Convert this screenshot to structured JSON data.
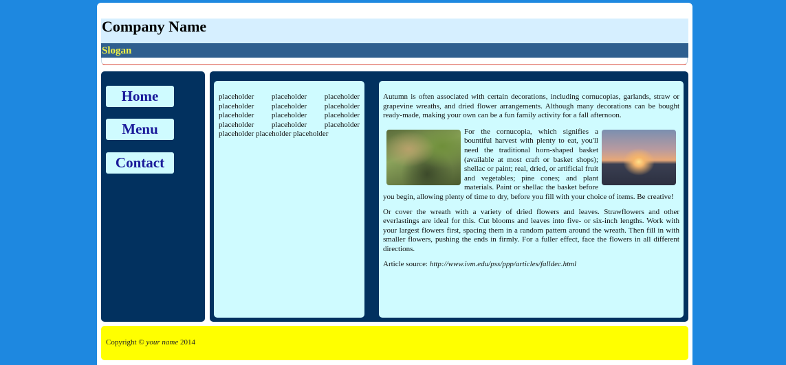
{
  "header": {
    "company_name": "Company Name",
    "slogan": "Slogan"
  },
  "nav": {
    "items": [
      {
        "label": "Home"
      },
      {
        "label": "Menu"
      },
      {
        "label": "Contact"
      }
    ]
  },
  "left_column": {
    "text": "placeholder placeholder placeholder placeholder placeholder placeholder placeholder placeholder placeholder placeholder placeholder placeholder placeholder placeholder placeholder"
  },
  "article": {
    "intro": "Autumn is often associated with certain decorations, including cornucopias, garlands, straw or grapevine wreaths, and dried flower arrangements. Although many decorations can be bought ready-made, making your own can be a fun family activity for a fall afternoon.",
    "cornucopia": "For the cornucopia, which signifies a bountiful harvest with plenty to eat, you'll need the traditional horn-shaped basket (available at most craft or basket shops); shellac or paint; real, dried, or artificial fruit and vegetables; pine cones; and plant materials. Paint or shellac the basket before you begin, allowing plenty of time to dry, before you fill with your choice of items. Be creative!",
    "wreath": "Or cover the wreath with a variety of dried flowers and leaves. Strawflowers and other everlastings are ideal for this. Cut blooms and leaves into five- or six-inch lengths. Work with your largest flowers first, spacing them in a random pattern around the wreath. Then fill in with smaller flowers, pushing the ends in firmly. For a fuller effect, face the flowers in all different directions.",
    "source_label": "Article source:",
    "source_url": "http://www.ivm.edu/pss/ppp/articles/falldec.html"
  },
  "footer": {
    "copyright_prefix": "Copyright ©",
    "name": "your name",
    "year": "2014"
  }
}
